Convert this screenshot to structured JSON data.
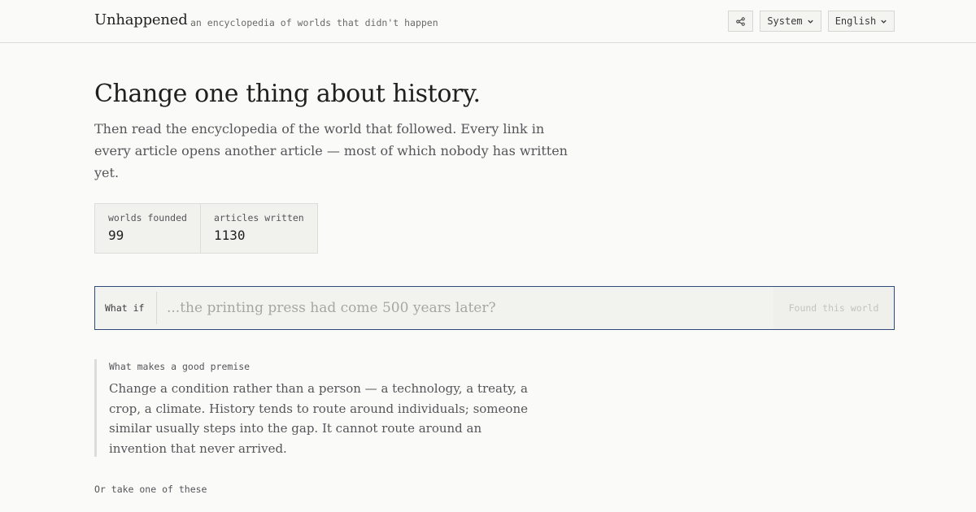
{
  "header": {
    "brand": "Unhappened",
    "tagline": "an encyclopedia of worlds that didn't happen",
    "share_icon": "share-icon",
    "theme_label": "System",
    "language_label": "English"
  },
  "hero": {
    "title": "Change one thing about history.",
    "subtitle": "Then read the encyclopedia of the world that followed. Every link in every article opens another article — most of which nobody has written yet."
  },
  "stats": [
    {
      "label": "worlds founded",
      "value": "99"
    },
    {
      "label": "articles written",
      "value": "1130"
    }
  ],
  "whatif": {
    "label": "What if",
    "placeholder": "...the printing press had come 500 years later?",
    "value": "",
    "button_label": "Found this world"
  },
  "advice": {
    "heading": "What makes a good premise",
    "body": "Change a condition rather than a person — a technology, a treaty, a crop, a climate. History tends to route around individuals; someone similar usually steps into the gap. It cannot route around an invention that never arrived."
  },
  "suggestions": {
    "heading": "Or take one of these"
  },
  "colors": {
    "background": "#fafaf8",
    "accent_border": "#2f4a7a",
    "muted_text": "#55555a"
  }
}
